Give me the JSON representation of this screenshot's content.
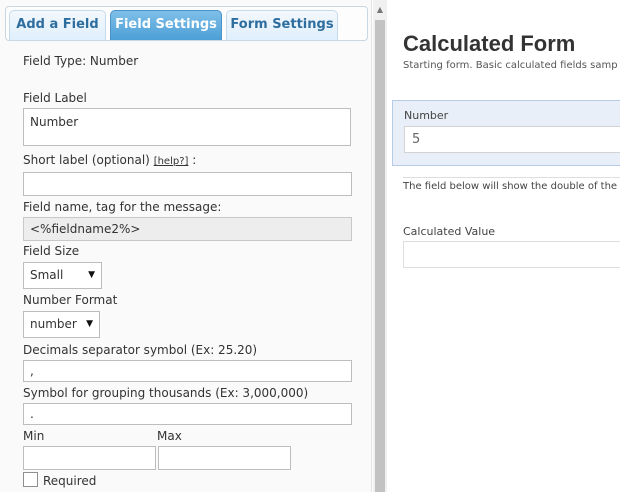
{
  "tabs": [
    {
      "label": "Add a Field",
      "active": false
    },
    {
      "label": "Field Settings",
      "active": true
    },
    {
      "label": "Form Settings",
      "active": false
    }
  ],
  "settings": {
    "field_type": "Field Type: Number",
    "field_label": {
      "label": "Field Label",
      "value": "Number"
    },
    "short_label": {
      "label": "Short label (optional)",
      "help": "[help?]",
      "suffix": ":",
      "value": ""
    },
    "field_name": {
      "label": "Field name, tag for the message:",
      "value": "<%fieldname2%>"
    },
    "field_size": {
      "label": "Field Size",
      "value": "Small"
    },
    "number_format": {
      "label": "Number Format",
      "value": "number"
    },
    "decimals": {
      "label": "Decimals separator symbol (Ex: 25.20)",
      "value": ","
    },
    "thousands": {
      "label": "Symbol for grouping thousands (Ex: 3,000,000)",
      "value": "."
    },
    "min": {
      "label": "Min",
      "value": ""
    },
    "max": {
      "label": "Max",
      "value": ""
    },
    "required": {
      "label": "Required",
      "checked": false
    }
  },
  "preview": {
    "title": "Calculated Form",
    "description": "Starting form. Basic calculated fields samp",
    "number_field": {
      "label": "Number",
      "value": "5"
    },
    "note": "The field below will show the double of the",
    "calculated_field": {
      "label": "Calculated Value",
      "value": ""
    }
  },
  "colors": {
    "tab_active": "#4c9fd6",
    "tab_text": "#2e6e9e",
    "preview_highlight": "#e8eff9"
  },
  "icons": {
    "select_caret": "▼",
    "scroll_up": "▲"
  }
}
